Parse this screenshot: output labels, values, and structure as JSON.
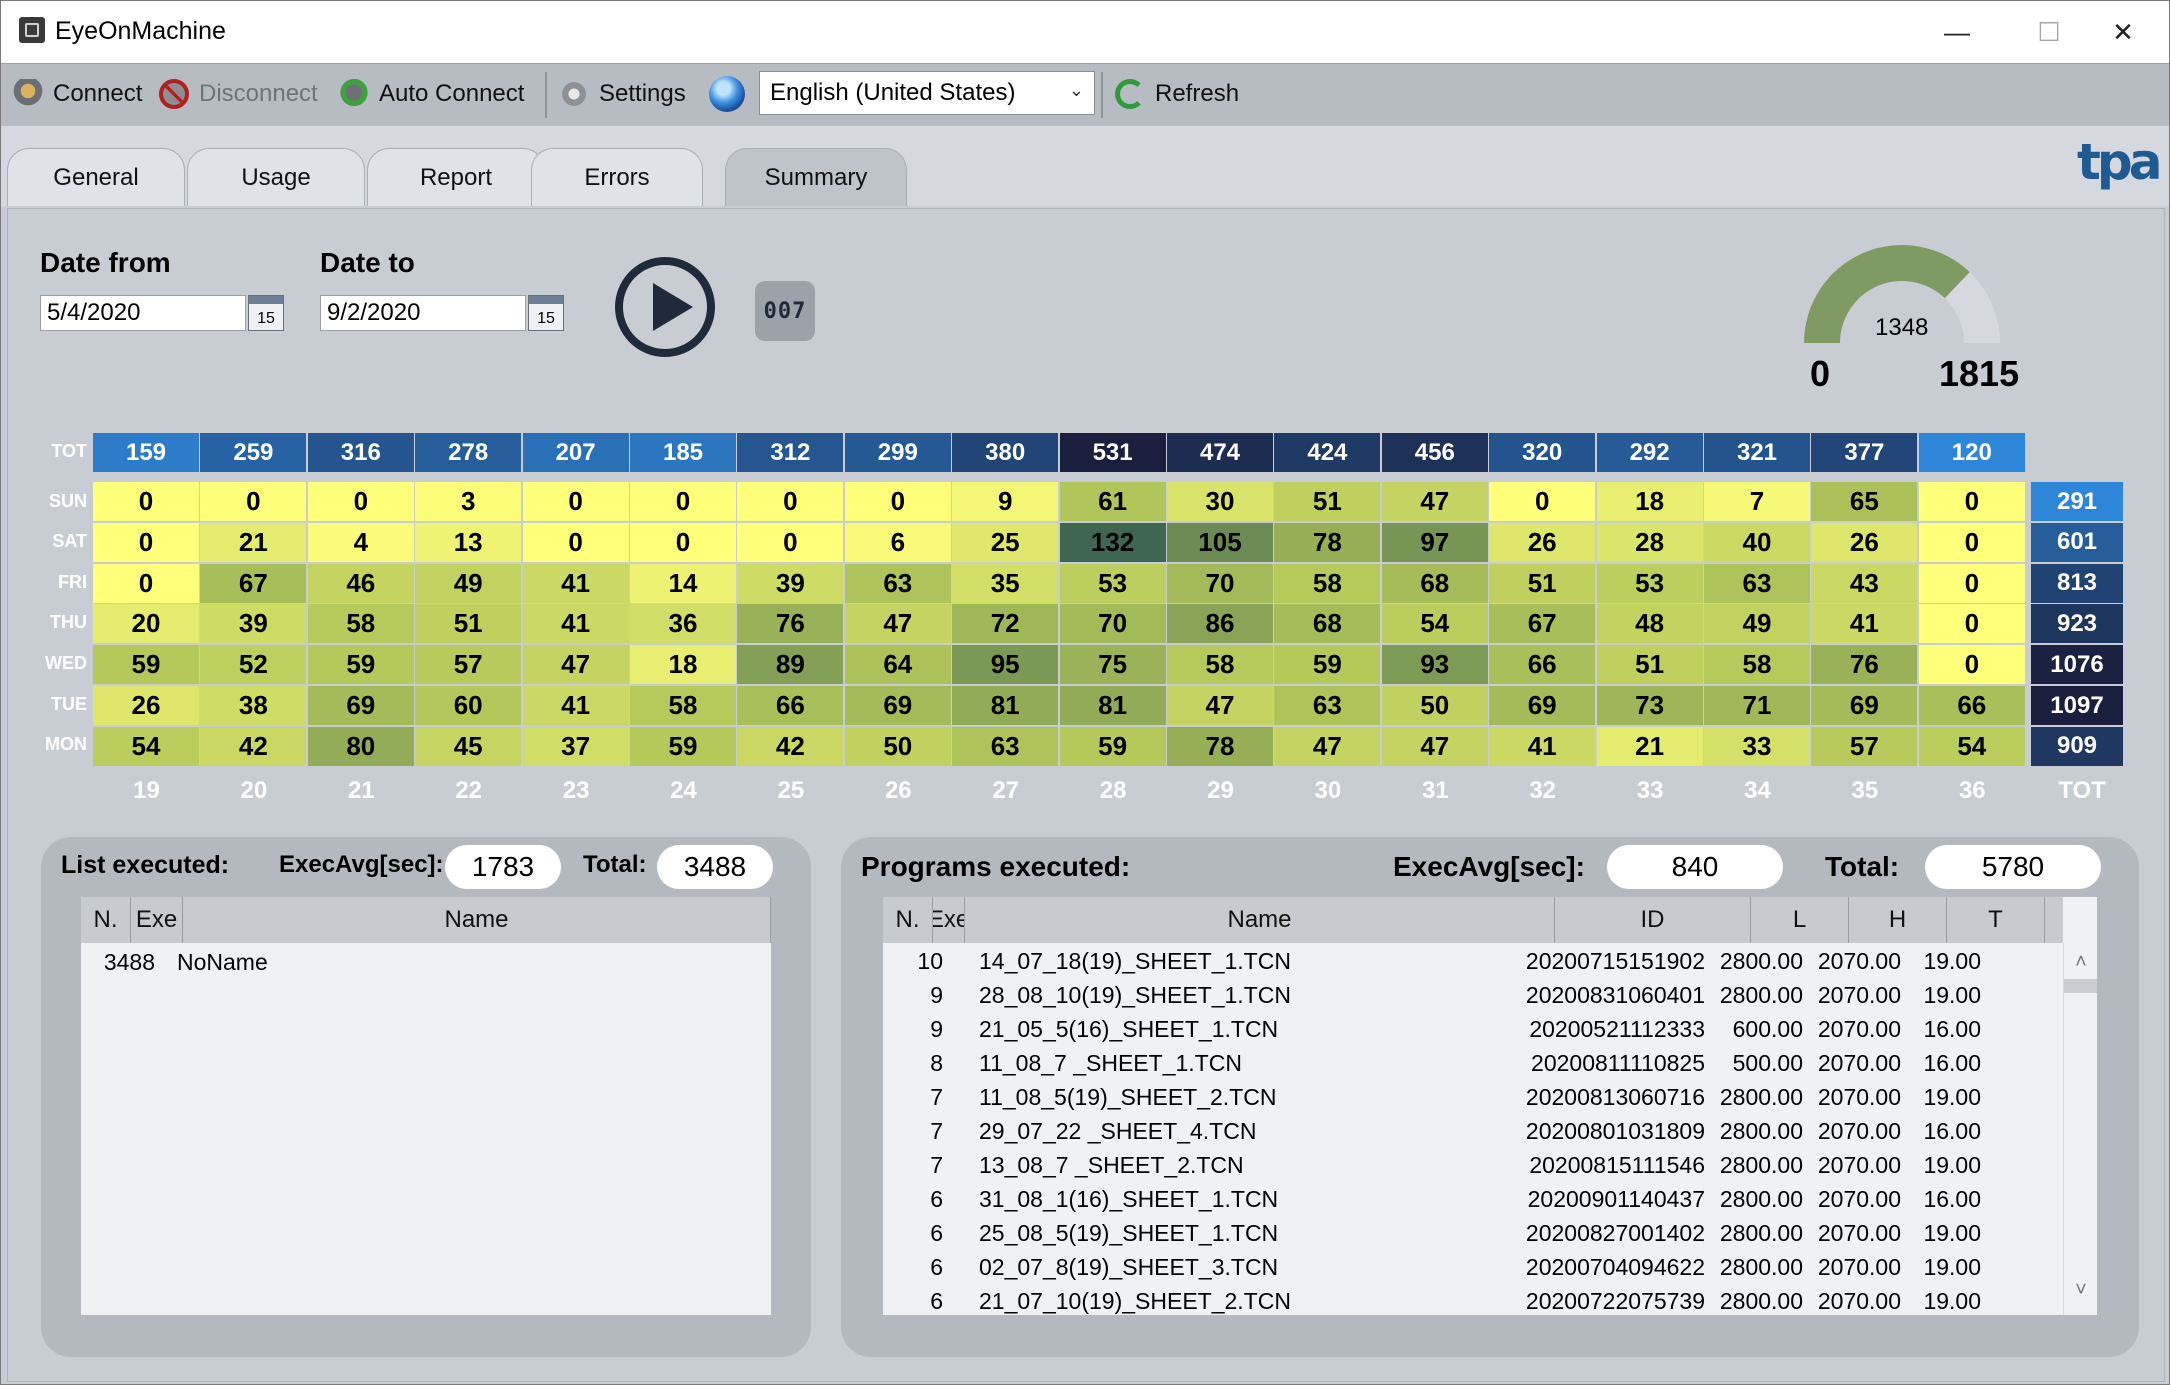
{
  "window": {
    "title": "EyeOnMachine",
    "min_glyph": "—",
    "max_glyph": "☐",
    "close_glyph": "✕"
  },
  "toolbar": {
    "connect_label": "Connect",
    "disconnect_label": "Disconnect",
    "auto_connect_label": "Auto Connect",
    "settings_label": "Settings",
    "language": "English (United States)",
    "refresh_label": "Refresh"
  },
  "tabs": [
    "General",
    "Usage",
    "Report",
    "Errors",
    "Summary"
  ],
  "logo_text": "tpa",
  "filter": {
    "date_from_label": "Date from",
    "date_from": "5/4/2020",
    "date_to_label": "Date to",
    "date_to": "9/2/2020",
    "calendar_day": "15",
    "counter_glyph": "007"
  },
  "gauge": {
    "value": 1348,
    "min": "0",
    "max": "1815",
    "value_text": "1348"
  },
  "heatmap": {
    "tot_label": "TOT",
    "days": [
      "SUN",
      "SAT",
      "FRI",
      "THU",
      "WED",
      "TUE",
      "MON"
    ],
    "weeks": [
      "19",
      "20",
      "21",
      "22",
      "23",
      "24",
      "25",
      "26",
      "27",
      "28",
      "29",
      "30",
      "31",
      "32",
      "33",
      "34",
      "35",
      "36"
    ],
    "week_totals": [
      "159",
      "259",
      "316",
      "278",
      "207",
      "185",
      "312",
      "299",
      "380",
      "531",
      "474",
      "424",
      "456",
      "320",
      "292",
      "321",
      "377",
      "120"
    ],
    "rows": [
      [
        "0",
        "0",
        "0",
        "3",
        "0",
        "0",
        "0",
        "0",
        "9",
        "61",
        "30",
        "51",
        "47",
        "0",
        "18",
        "7",
        "65",
        "0"
      ],
      [
        "0",
        "21",
        "4",
        "13",
        "0",
        "0",
        "0",
        "6",
        "25",
        "132",
        "105",
        "78",
        "97",
        "26",
        "28",
        "40",
        "26",
        "0"
      ],
      [
        "0",
        "67",
        "46",
        "49",
        "41",
        "14",
        "39",
        "63",
        "35",
        "53",
        "70",
        "58",
        "68",
        "51",
        "53",
        "63",
        "43",
        "0"
      ],
      [
        "20",
        "39",
        "58",
        "51",
        "41",
        "36",
        "76",
        "47",
        "72",
        "70",
        "86",
        "68",
        "54",
        "67",
        "48",
        "49",
        "41",
        "0"
      ],
      [
        "59",
        "52",
        "59",
        "57",
        "47",
        "18",
        "89",
        "64",
        "95",
        "75",
        "58",
        "59",
        "93",
        "66",
        "51",
        "58",
        "76",
        "0"
      ],
      [
        "26",
        "38",
        "69",
        "60",
        "41",
        "58",
        "66",
        "69",
        "81",
        "81",
        "47",
        "63",
        "50",
        "69",
        "73",
        "71",
        "69",
        "66"
      ],
      [
        "54",
        "42",
        "80",
        "45",
        "37",
        "59",
        "42",
        "50",
        "63",
        "59",
        "78",
        "47",
        "47",
        "41",
        "21",
        "33",
        "57",
        "54"
      ]
    ],
    "day_totals": [
      "291",
      "601",
      "813",
      "923",
      "1076",
      "1097",
      "909"
    ],
    "tot_col_label": "TOT"
  },
  "list_executed": {
    "title": "List executed:",
    "exec_avg_label": "ExecAvg[sec]:",
    "exec_avg": "1783",
    "total_label": "Total:",
    "total": "3488",
    "columns": [
      "N.",
      "Exe",
      "Name"
    ],
    "rows": [
      {
        "n": "3488",
        "name": "NoName"
      }
    ]
  },
  "programs_executed": {
    "title": "Programs executed:",
    "exec_avg_label": "ExecAvg[sec]:",
    "exec_avg": "840",
    "total_label": "Total:",
    "total": "5780",
    "columns": [
      "N.",
      "Exe",
      "Name",
      "ID",
      "L",
      "H",
      "T"
    ],
    "rows": [
      {
        "n": "10",
        "name": "14_07_18(19)_SHEET_1.TCN",
        "id": "20200715151902",
        "l": "2800.00",
        "h": "2070.00",
        "t": "19.00"
      },
      {
        "n": "9",
        "name": "28_08_10(19)_SHEET_1.TCN",
        "id": "20200831060401",
        "l": "2800.00",
        "h": "2070.00",
        "t": "19.00"
      },
      {
        "n": "9",
        "name": "21_05_5(16)_SHEET_1.TCN",
        "id": "20200521112333",
        "l": "600.00",
        "h": "2070.00",
        "t": "16.00"
      },
      {
        "n": "8",
        "name": "11_08_7 _SHEET_1.TCN",
        "id": "20200811110825",
        "l": "500.00",
        "h": "2070.00",
        "t": "16.00"
      },
      {
        "n": "7",
        "name": "11_08_5(19)_SHEET_2.TCN",
        "id": "20200813060716",
        "l": "2800.00",
        "h": "2070.00",
        "t": "19.00"
      },
      {
        "n": "7",
        "name": "29_07_22 _SHEET_4.TCN",
        "id": "20200801031809",
        "l": "2800.00",
        "h": "2070.00",
        "t": "16.00"
      },
      {
        "n": "7",
        "name": "13_08_7 _SHEET_2.TCN",
        "id": "20200815111546",
        "l": "2800.00",
        "h": "2070.00",
        "t": "19.00"
      },
      {
        "n": "6",
        "name": "31_08_1(16)_SHEET_1.TCN",
        "id": "20200901140437",
        "l": "2800.00",
        "h": "2070.00",
        "t": "16.00"
      },
      {
        "n": "6",
        "name": "25_08_5(19)_SHEET_1.TCN",
        "id": "20200827001402",
        "l": "2800.00",
        "h": "2070.00",
        "t": "19.00"
      },
      {
        "n": "6",
        "name": "02_07_8(19)_SHEET_3.TCN",
        "id": "20200704094622",
        "l": "2800.00",
        "h": "2070.00",
        "t": "19.00"
      },
      {
        "n": "6",
        "name": "21_07_10(19)_SHEET_2.TCN",
        "id": "20200722075739",
        "l": "2800.00",
        "h": "2070.00",
        "t": "19.00"
      }
    ],
    "scroll_up_glyph": "˄",
    "scroll_down_glyph": "˅"
  },
  "colors": {
    "gauge_fill": "#7f9a63",
    "gauge_track": "#d5d8dd",
    "heat_low": "#ffff7a",
    "heat_high": "#3f6650",
    "tot_low": "#2e86d8",
    "tot_high": "#1a1f3d"
  }
}
